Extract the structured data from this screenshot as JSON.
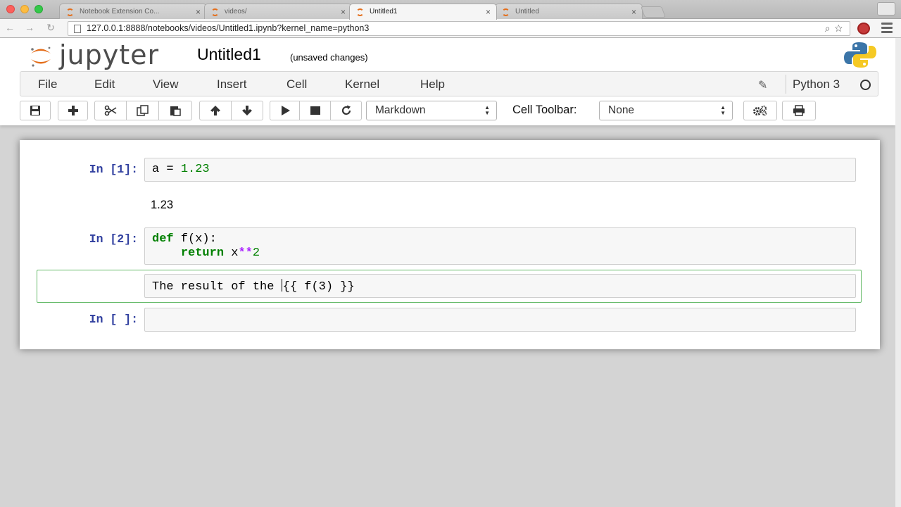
{
  "browser": {
    "tabs": [
      {
        "title": "Notebook Extension Co...",
        "active": false
      },
      {
        "title": "videos/",
        "active": false
      },
      {
        "title": "Untitled1",
        "active": true
      },
      {
        "title": "Untitled",
        "active": false
      }
    ],
    "tab_close_glyph": "×",
    "url": "127.0.0.1:8888/notebooks/videos/Untitled1.ipynb?kernel_name=python3",
    "nav_icons": [
      "back-arrow-icon",
      "forward-arrow-icon",
      "reload-icon"
    ]
  },
  "header": {
    "logo_text": "jupyter",
    "notebook_name": "Untitled1",
    "save_status": "(unsaved changes)"
  },
  "menu": {
    "items": [
      "File",
      "Edit",
      "View",
      "Insert",
      "Cell",
      "Kernel",
      "Help"
    ],
    "kernel_name": "Python 3"
  },
  "toolbar": {
    "cell_type": "Markdown",
    "cell_toolbar_label": "Cell Toolbar:",
    "cell_toolbar_value": "None"
  },
  "cells": [
    {
      "prompt": "In [1]:",
      "type": "code",
      "source_var": "a = ",
      "source_num": "1.23",
      "output": "1.23"
    },
    {
      "prompt": "In [2]:",
      "type": "code",
      "line1_kw": "def",
      "line1_rest": " f(x):",
      "line2_kw": "return",
      "line2_var": " x",
      "line2_op": "**",
      "line2_num": "2"
    },
    {
      "prompt": "",
      "type": "markdown",
      "text_before": "The result of the ",
      "text_after": "{{ f(3) }}"
    },
    {
      "prompt": "In [ ]:",
      "type": "code",
      "source": ""
    }
  ],
  "colors": {
    "prompt": "#303f9f",
    "keyword": "#008000",
    "operator": "#aa22ff",
    "selected_cell_border": "#66bb6a"
  }
}
